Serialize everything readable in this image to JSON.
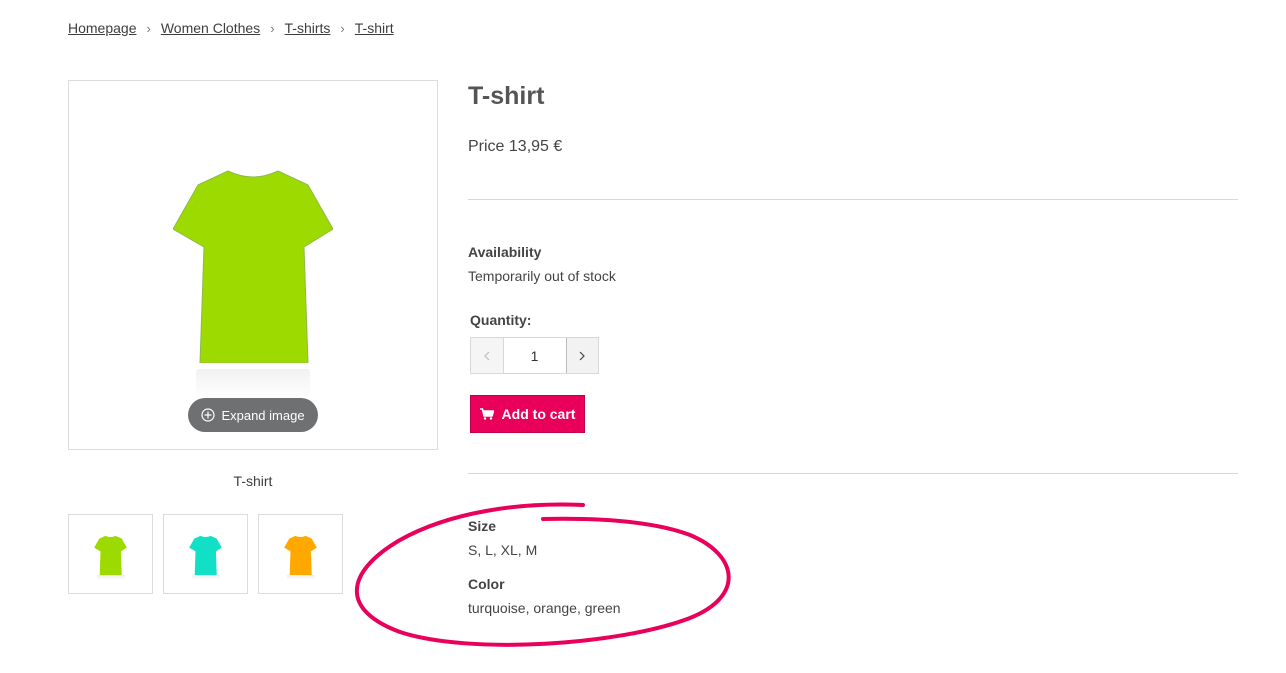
{
  "breadcrumb": {
    "items": [
      "Homepage",
      "Women Clothes",
      "T-shirts",
      "T-shirt"
    ],
    "separator": "›"
  },
  "gallery": {
    "main_image": {
      "icon": "tshirt-green-image",
      "color": "#9ddb00"
    },
    "expand_label": "Expand image",
    "caption": "T-shirt",
    "thumbnails": [
      {
        "icon": "tshirt-green-thumb",
        "color": "#9ddb00"
      },
      {
        "icon": "tshirt-turquoise-thumb",
        "color": "#12e0c6"
      },
      {
        "icon": "tshirt-orange-thumb",
        "color": "#ffa800"
      }
    ]
  },
  "product": {
    "title": "T-shirt",
    "price": "Price 13,95 €",
    "availability_label": "Availability",
    "availability_value": "Temporarily out of stock",
    "quantity_label": "Quantity:",
    "quantity_value": "1",
    "add_to_cart_label": "Add to cart"
  },
  "attributes": {
    "size_label": "Size",
    "size_value": "S, L, XL, M",
    "color_label": "Color",
    "color_value": "turquoise, orange, green"
  },
  "colors": {
    "accent": "#e8005a",
    "annotation_circle": "#e8005a",
    "text": "#3d3d3d"
  }
}
